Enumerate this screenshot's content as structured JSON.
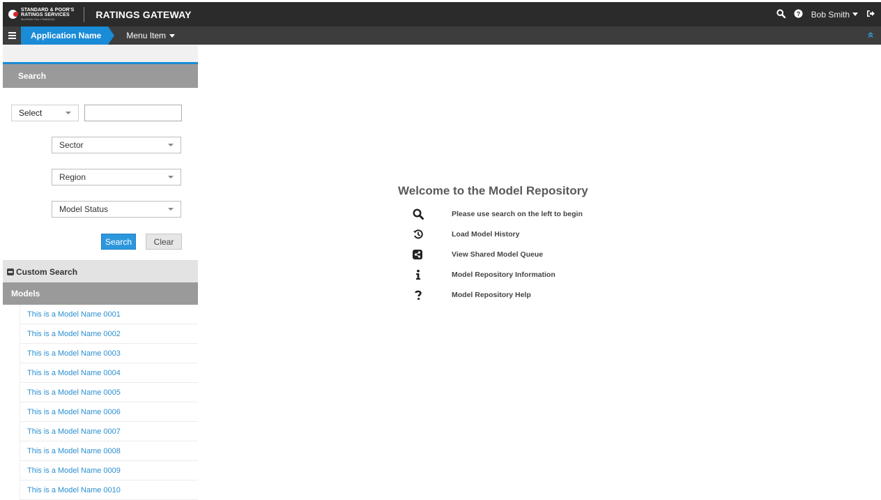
{
  "header": {
    "logo_lines": [
      "STANDARD & POOR'S",
      "RATINGS SERVICES",
      "McGRAW HILL FINANCIAL"
    ],
    "app_title": "RATINGS GATEWAY",
    "user_name": "Bob Smith"
  },
  "menubar": {
    "app_name": "Application Name",
    "menu_item": "Menu Item"
  },
  "sidebar": {
    "search_header": "Search",
    "select_label": "Select",
    "search_input_value": "",
    "dropdowns": [
      "Sector",
      "Region",
      "Model Status"
    ],
    "search_button": "Search",
    "clear_button": "Clear",
    "custom_search": "Custom Search",
    "models_header": "Models",
    "models": [
      "This is a Model Name 0001",
      "This is a Model Name 0002",
      "This is a Model Name 0003",
      "This is a Model Name 0004",
      "This is a Model Name 0005",
      "This is a Model Name 0006",
      "This is a Model Name 0007",
      "This is a Model Name 0008",
      "This is a Model Name 0009",
      "This is a Model Name 0010"
    ]
  },
  "main": {
    "title": "Welcome to the Model Repository",
    "items": [
      {
        "icon": "search-icon",
        "label": "Please use search on the left to begin"
      },
      {
        "icon": "history-icon",
        "label": "Load Model History"
      },
      {
        "icon": "share-icon",
        "label": "View Shared Model Queue"
      },
      {
        "icon": "info-icon",
        "label": "Model Repository Information"
      },
      {
        "icon": "question-icon",
        "label": "Model Repository Help"
      }
    ]
  },
  "colors": {
    "accent": "#1a8bd6",
    "header_bg": "#2b2b2b",
    "menubar_bg": "#3d3d3d",
    "panel_header_bg": "#9a9a9a",
    "link": "#2b8fd0"
  }
}
